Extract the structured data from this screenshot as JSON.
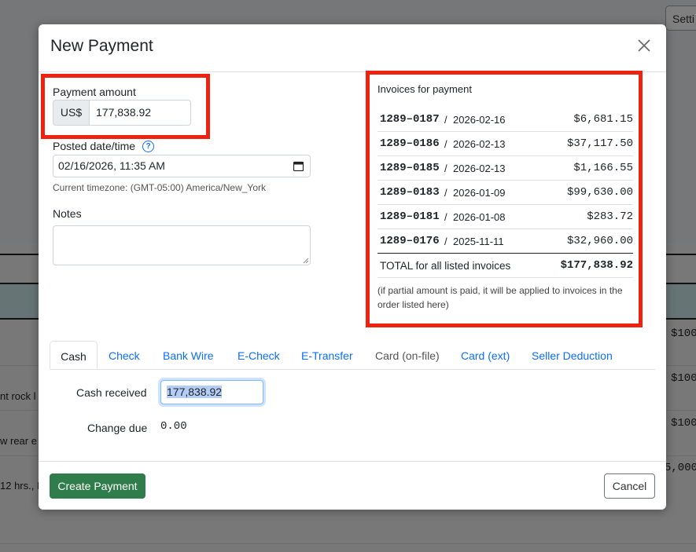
{
  "background": {
    "settings_label": "Setti",
    "rows": [
      {
        "left": "",
        "right": "$100"
      },
      {
        "left": "nt rock l",
        "right": "$100"
      },
      {
        "left": "w rear e",
        "right": "$100"
      },
      {
        "left": "12 hrs., N",
        "right": "5,000"
      }
    ]
  },
  "modal": {
    "title": "New Payment",
    "payment_amount": {
      "label": "Payment amount",
      "currency": "US$",
      "value": "177,838.92"
    },
    "posted": {
      "label": "Posted date/time",
      "value": "02/16/2026, 11:35 AM",
      "timezone": "Current timezone: (GMT-05:00) America/New_York"
    },
    "notes_label": "Notes",
    "invoices": {
      "title": "Invoices for payment",
      "rows": [
        {
          "number": "1289–0187",
          "sep": "/",
          "date": "2026-02-16",
          "amount": "$6,681.15"
        },
        {
          "number": "1289–0186",
          "sep": "/",
          "date": "2026-02-13",
          "amount": "$37,117.50"
        },
        {
          "number": "1289–0185",
          "sep": "/",
          "date": "2026-02-13",
          "amount": "$1,166.55"
        },
        {
          "number": "1289–0183",
          "sep": "/",
          "date": "2026-01-09",
          "amount": "$99,630.00"
        },
        {
          "number": "1289–0181",
          "sep": "/",
          "date": "2026-01-08",
          "amount": "$283.72"
        },
        {
          "number": "1289–0176",
          "sep": "/",
          "date": "2025-11-11",
          "amount": "$32,960.00"
        }
      ],
      "total_label": "TOTAL for all listed invoices",
      "total_amount": "$177,838.92",
      "note": "(if partial amount is paid, it will be applied to invoices in the order listed here)"
    },
    "tabs": [
      {
        "label": "Cash"
      },
      {
        "label": "Check"
      },
      {
        "label": "Bank Wire"
      },
      {
        "label": "E-Check"
      },
      {
        "label": "E-Transfer"
      },
      {
        "label": "Card (on-file)"
      },
      {
        "label": "Card (ext)"
      },
      {
        "label": "Seller Deduction"
      }
    ],
    "cash": {
      "received_label": "Cash received",
      "received_value": "177,838.92",
      "change_label": "Change due",
      "change_value": "0.00"
    },
    "footer": {
      "create_label": "Create Payment",
      "cancel_label": "Cancel"
    }
  },
  "colors": {
    "highlight_box": "#ee2211",
    "primary_link": "#0d6efd",
    "create_button": "#2f7d4a"
  }
}
